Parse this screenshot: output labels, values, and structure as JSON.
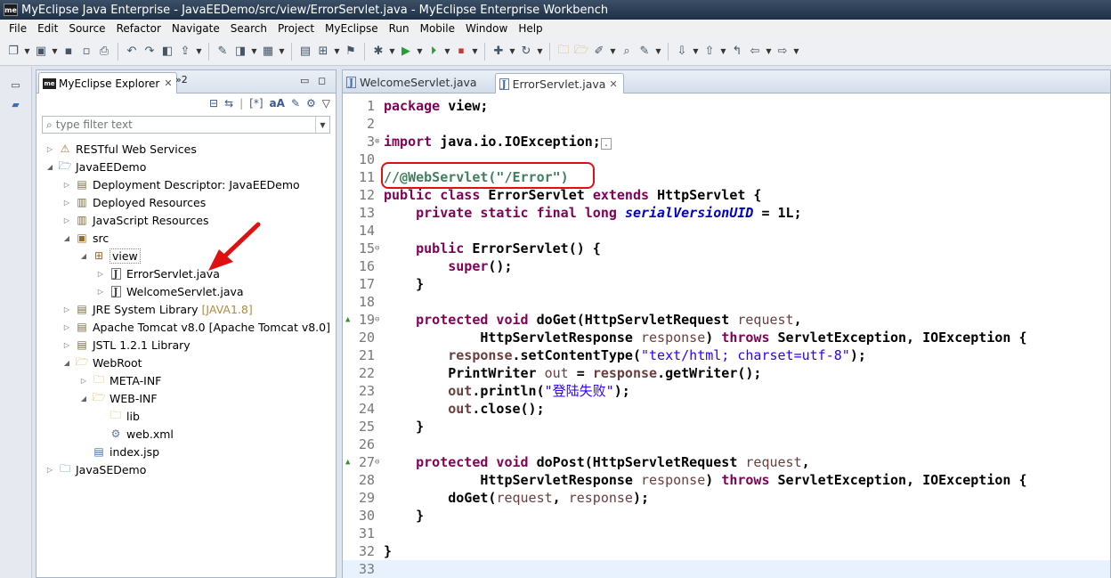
{
  "window": {
    "logo_text": "me",
    "title": "MyEclipse Java Enterprise - JavaEEDemo/src/view/ErrorServlet.java - MyEclipse Enterprise Workbench"
  },
  "menu": [
    "File",
    "Edit",
    "Source",
    "Refactor",
    "Navigate",
    "Search",
    "Project",
    "MyEclipse",
    "Run",
    "Mobile",
    "Window",
    "Help"
  ],
  "explorer": {
    "logo_text": "me",
    "tab_label": "MyEclipse Explorer",
    "tab_close": "✕",
    "overflow_label": "»2",
    "filter_placeholder": "type filter text",
    "tree": [
      {
        "label": "RESTful Web Services",
        "icon": "restful-services-icon",
        "glyph": "⚠",
        "indent": 0,
        "toggle": "▷"
      },
      {
        "label": "JavaEEDemo",
        "icon": "web-project-icon",
        "glyph": "🗁",
        "indent": 0,
        "toggle": "◢"
      },
      {
        "label": "Deployment Descriptor: JavaEEDemo",
        "icon": "deployment-descriptor-icon",
        "glyph": "▤",
        "indent": 1,
        "toggle": "▷"
      },
      {
        "label": "Deployed Resources",
        "icon": "deployed-resources-icon",
        "glyph": "▥",
        "indent": 1,
        "toggle": "▷"
      },
      {
        "label": "JavaScript Resources",
        "icon": "javascript-resources-icon",
        "glyph": "▥",
        "indent": 1,
        "toggle": "▷"
      },
      {
        "label": "src",
        "icon": "source-folder-icon",
        "glyph": "▣",
        "indent": 1,
        "toggle": "◢"
      },
      {
        "label": "view",
        "icon": "package-icon",
        "glyph": "⊞",
        "indent": 2,
        "toggle": "◢",
        "selected": true
      },
      {
        "label": "ErrorServlet.java",
        "icon": "java-file-icon",
        "glyph": "J",
        "indent": 3,
        "toggle": "▷"
      },
      {
        "label": "WelcomeServlet.java",
        "icon": "java-file-icon",
        "glyph": "J",
        "indent": 3,
        "toggle": "▷"
      },
      {
        "label": "JRE System Library",
        "suffix": "[JAVA1.8]",
        "icon": "library-icon",
        "glyph": "▤",
        "indent": 1,
        "toggle": "▷"
      },
      {
        "label": "Apache Tomcat v8.0 [Apache Tomcat v8.0]",
        "icon": "library-icon",
        "glyph": "▤",
        "indent": 1,
        "toggle": "▷"
      },
      {
        "label": "JSTL 1.2.1 Library",
        "icon": "library-icon",
        "glyph": "▤",
        "indent": 1,
        "toggle": "▷"
      },
      {
        "label": "WebRoot",
        "icon": "folder-icon",
        "glyph": "🗁",
        "indent": 1,
        "toggle": "◢"
      },
      {
        "label": "META-INF",
        "icon": "folder-icon",
        "glyph": "🗀",
        "indent": 2,
        "toggle": "▷"
      },
      {
        "label": "WEB-INF",
        "icon": "folder-icon",
        "glyph": "🗁",
        "indent": 2,
        "toggle": "◢"
      },
      {
        "label": "lib",
        "icon": "folder-icon",
        "glyph": "🗀",
        "indent": 3,
        "toggle": ""
      },
      {
        "label": "web.xml",
        "icon": "xml-file-icon",
        "glyph": "⚙",
        "indent": 3,
        "toggle": ""
      },
      {
        "label": "index.jsp",
        "icon": "jsp-file-icon",
        "glyph": "▤",
        "indent": 2,
        "toggle": ""
      },
      {
        "label": "JavaSEDemo",
        "icon": "java-project-icon",
        "glyph": "🗀",
        "indent": 0,
        "toggle": "▷"
      }
    ]
  },
  "editor": {
    "tabs": [
      {
        "label": "WelcomeServlet.java",
        "active": false
      },
      {
        "label": "ErrorServlet.java",
        "active": true,
        "close": "✕"
      }
    ],
    "lines": [
      {
        "n": "1",
        "html": "<span class='kw'>package</span> <span class='b'>view;</span>"
      },
      {
        "n": "2",
        "html": ""
      },
      {
        "n": "3",
        "fold": "⊕",
        "html": "<span class='kw'>import</span> <span class='b'>java.io.IOException;</span><span style='border:1px solid #999;font-size:10px;padding:0 2px;color:#555;'>.</span>"
      },
      {
        "n": "10",
        "html": ""
      },
      {
        "n": "11",
        "html": "<span class='ann b'>//@WebServlet(\"/Error\")</span>"
      },
      {
        "n": "12",
        "html": "<span class='kw'>public class</span> <span class='b'>ErrorServlet</span> <span class='kw'>extends</span> <span class='b'>HttpServlet {</span>"
      },
      {
        "n": "13",
        "html": "    <span class='kw'>private static final long</span> <span class='ital'>serialVersionUID</span> <span class='b'>= 1L;</span>"
      },
      {
        "n": "14",
        "html": ""
      },
      {
        "n": "15",
        "fold": "⊖",
        "html": "    <span class='kw'>public</span> <span class='b'>ErrorServlet() {</span>"
      },
      {
        "n": "16",
        "html": "        <span class='kw'>super</span><span class='b'>();</span>"
      },
      {
        "n": "17",
        "html": "    <span class='b'>}</span>"
      },
      {
        "n": "18",
        "html": ""
      },
      {
        "n": "19",
        "fold": "⊖",
        "marker": "▲",
        "html": "    <span class='kw'>protected void</span> <span class='b'>doGet(HttpServletRequest</span> <span class='param'>request</span><span class='b'>,</span>"
      },
      {
        "n": "20",
        "html": "            <span class='b'>HttpServletResponse</span> <span class='param'>response</span><span class='b'>)</span> <span class='kw'>throws</span> <span class='b'>ServletException, IOException {</span>"
      },
      {
        "n": "21",
        "html": "        <span class='param b'>response</span><span class='b'>.setContentType(</span><span class='str'>\"text/html; charset=utf-8\"</span><span class='b'>);</span>"
      },
      {
        "n": "22",
        "html": "        <span class='b'>PrintWriter</span> <span class='param'>out</span> <span class='b'>=</span> <span class='param b'>response</span><span class='b'>.getWriter();</span>"
      },
      {
        "n": "23",
        "html": "        <span class='param b'>out</span><span class='b'>.println(</span><span class='str'>\"登陆失败\"</span><span class='b'>);</span>"
      },
      {
        "n": "24",
        "html": "        <span class='param b'>out</span><span class='b'>.close();</span>"
      },
      {
        "n": "25",
        "html": "    <span class='b'>}</span>"
      },
      {
        "n": "26",
        "html": ""
      },
      {
        "n": "27",
        "fold": "⊖",
        "marker": "▲",
        "html": "    <span class='kw'>protected void</span> <span class='b'>doPost(HttpServletRequest</span> <span class='param'>request</span><span class='b'>,</span>"
      },
      {
        "n": "28",
        "html": "            <span class='b'>HttpServletResponse</span> <span class='param'>response</span><span class='b'>)</span> <span class='kw'>throws</span> <span class='b'>ServletException, IOException {</span>"
      },
      {
        "n": "29",
        "html": "        <span class='b'>doGet(</span><span class='param'>request</span><span class='b'>,</span> <span class='param'>response</span><span class='b'>);</span>"
      },
      {
        "n": "30",
        "html": "    <span class='b'>}</span>"
      },
      {
        "n": "31",
        "html": ""
      },
      {
        "n": "32",
        "html": "<span class='b'>}</span>"
      },
      {
        "n": "33",
        "html": "",
        "current": true
      }
    ]
  },
  "colors": {
    "keyword": "#7f0055",
    "string": "#2a00ff",
    "annotation": "#3f7f5f",
    "highlight_box": "#e01010"
  }
}
